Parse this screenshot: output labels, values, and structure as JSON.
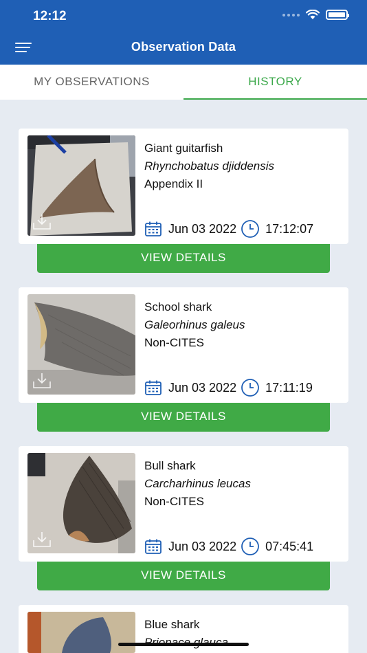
{
  "status": {
    "time": "12:12"
  },
  "header": {
    "title": "Observation Data",
    "menu_icon": "hamburger-menu-icon"
  },
  "tabs": [
    {
      "label": "MY OBSERVATIONS",
      "active": false
    },
    {
      "label": "HISTORY",
      "active": true
    }
  ],
  "colors": {
    "primary": "#1f5fb5",
    "accent_green": "#40aa46",
    "background": "#e6ebf2"
  },
  "observations": [
    {
      "common_name": "Giant guitarfish",
      "scientific_name": "Rhynchobatus djiddensis",
      "status": "Appendix II",
      "date": "Jun 03 2022",
      "time": "17:12:07",
      "button_label": "VIEW DETAILS"
    },
    {
      "common_name": "School shark",
      "scientific_name": "Galeorhinus galeus",
      "status": "Non-CITES",
      "date": "Jun 03 2022",
      "time": "17:11:19",
      "button_label": "VIEW DETAILS"
    },
    {
      "common_name": "Bull shark",
      "scientific_name": "Carcharhinus leucas",
      "status": "Non-CITES",
      "date": "Jun 03 2022",
      "time": "07:45:41",
      "button_label": "VIEW DETAILS"
    },
    {
      "common_name": "Blue shark",
      "scientific_name": "Prionace glauca"
    }
  ]
}
